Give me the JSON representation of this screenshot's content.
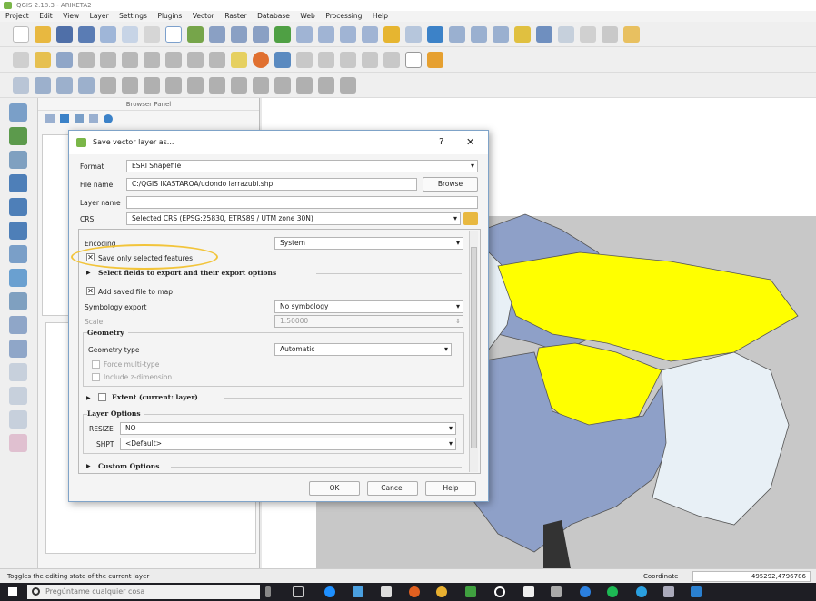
{
  "app": {
    "title": "QGIS 2.18.3 - ARIKETA2",
    "menu": [
      "Project",
      "Edit",
      "View",
      "Layer",
      "Settings",
      "Plugins",
      "Vector",
      "Raster",
      "Database",
      "Web",
      "Processing",
      "Help"
    ]
  },
  "browser_panel": {
    "title": "Browser Panel"
  },
  "dialog": {
    "title": "Save vector layer as...",
    "help": "?",
    "close": "✕",
    "format": {
      "label": "Format",
      "value": "ESRI Shapefile"
    },
    "file_name": {
      "label": "File name",
      "value": "C:/QGIS IKASTAROA/udondo larrazubi.shp",
      "browse": "Browse"
    },
    "layer_name": {
      "label": "Layer name",
      "value": ""
    },
    "crs": {
      "label": "CRS",
      "value": "Selected CRS (EPSG:25830, ETRS89 / UTM zone 30N)"
    },
    "encoding": {
      "label": "Encoding",
      "value": "System"
    },
    "save_selected": {
      "label": "Save only selected features",
      "checked": true
    },
    "select_fields": "Select fields to export and their export options",
    "add_to_map": {
      "label": "Add saved file to map",
      "checked": true
    },
    "symbology": {
      "label": "Symbology export",
      "value": "No symbology"
    },
    "scale": {
      "label": "Scale",
      "value": "1:50000"
    },
    "geometry": {
      "title": "Geometry",
      "type_label": "Geometry type",
      "type_value": "Automatic",
      "force_multi": "Force multi-type",
      "include_z": "Include z-dimension"
    },
    "extent": "Extent (current: layer)",
    "layer_options": {
      "title": "Layer Options",
      "resize": {
        "label": "RESIZE",
        "value": "NO"
      },
      "shpt": {
        "label": "SHPT",
        "value": "<Default>"
      }
    },
    "custom_options": "Custom Options",
    "buttons": {
      "ok": "OK",
      "cancel": "Cancel",
      "help": "Help"
    }
  },
  "status": {
    "message": "Toggles the editing state of the current layer",
    "coordinate_label": "Coordinate",
    "coordinate_value": "495292,4796786"
  },
  "taskbar": {
    "search_placeholder": "Pregúntame cualquier cosa"
  },
  "colors": {
    "selected": "#ffff00",
    "polygon_blue": "#8ea0c8",
    "polygon_light": "#e8f0f6",
    "highlight": "#f2c43a"
  }
}
